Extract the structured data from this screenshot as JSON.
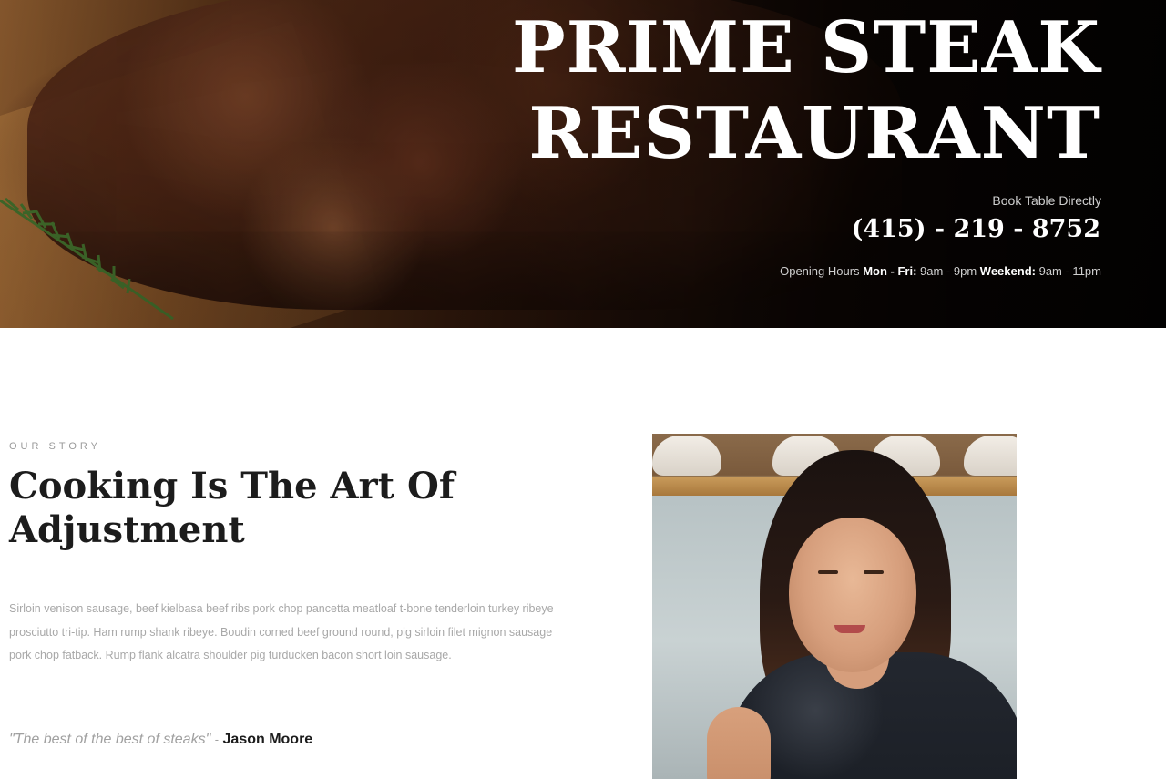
{
  "hero": {
    "title_line1": "PRIME STEAK",
    "title_line2": "RESTAURANT",
    "book_label": "Book Table Directly",
    "phone": "(415) - 219 - 8752",
    "hours": {
      "label": "Opening Hours",
      "weekday_label": "Mon - Fri:",
      "weekday_time": "9am - 9pm",
      "weekend_label": "Weekend:",
      "weekend_time": "9am - 11pm"
    }
  },
  "story": {
    "eyebrow": "OUR STORY",
    "heading_line1": "Cooking Is The Art Of",
    "heading_line2": "Adjustment",
    "body": "Sirloin venison sausage, beef kielbasa beef ribs pork chop pancetta meatloaf t-bone tenderloin turkey ribeye prosciutto tri-tip. Ham rump shank ribeye. Boudin corned beef ground round, pig sirloin filet mignon sausage pork chop fatback. Rump flank alcatra shoulder pig turducken bacon short loin sausage.",
    "quote": "\"The best of the best of steaks\"",
    "quote_separator": "-",
    "quote_author": "Jason Moore"
  },
  "colors": {
    "heading": "#1c1c1c",
    "muted_text": "#a8a8a8",
    "hero_text": "#ffffff"
  }
}
